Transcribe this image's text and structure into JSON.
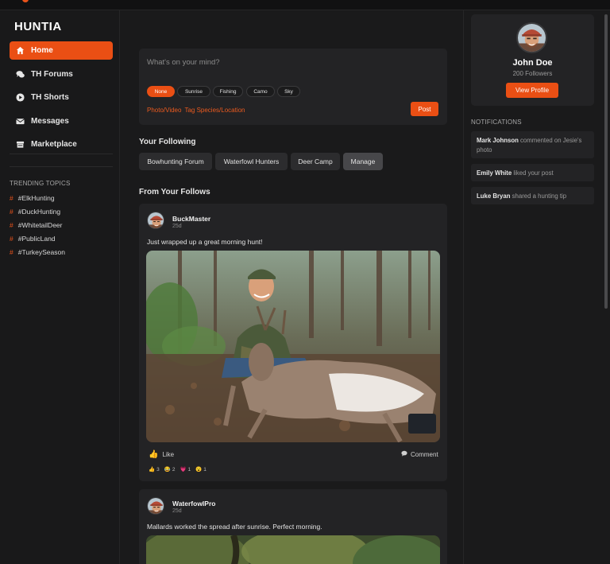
{
  "brand": "HUNTIA",
  "accent_color": "#ea4f14",
  "nav": [
    {
      "label": "Home",
      "icon": "home-icon",
      "active": true
    },
    {
      "label": "TH Forums",
      "icon": "chat-bubbles-icon",
      "active": false
    },
    {
      "label": "TH Shorts",
      "icon": "play-circle-icon",
      "active": false
    },
    {
      "label": "Messages",
      "icon": "envelope-icon",
      "active": false
    },
    {
      "label": "Marketplace",
      "icon": "storefront-icon",
      "active": false
    }
  ],
  "trending": {
    "title": "TRENDING TOPICS",
    "topics": [
      "#ElkHunting",
      "#DuckHunting",
      "#WhitetailDeer",
      "#PublicLand",
      "#TurkeySeason"
    ]
  },
  "composer": {
    "placeholder": "What's on your mind?",
    "filters": [
      "None",
      "Sunrise",
      "Fishing",
      "Camo",
      "Sky"
    ],
    "active_filter": "None",
    "photo_link": "Photo/Video",
    "tag_link": "Tag Species/Location",
    "post_label": "Post"
  },
  "following": {
    "title": "Your Following",
    "items": [
      "Bowhunting Forum",
      "Waterfowl Hunters",
      "Deer Camp"
    ],
    "manage_label": "Manage"
  },
  "feed": {
    "title": "From Your Follows",
    "posts": [
      {
        "author": "BuckMaster",
        "time": "25d",
        "text": "Just wrapped up a great morning hunt!",
        "like_label": "Like",
        "comment_label": "Comment",
        "reactions": [
          {
            "icon": "thumbs-up-icon",
            "count": "3"
          },
          {
            "icon": "laugh-icon",
            "count": "2"
          },
          {
            "icon": "heart-icon",
            "count": "1"
          },
          {
            "icon": "wow-icon",
            "count": "1"
          }
        ]
      },
      {
        "author": "WaterfowlPro",
        "time": "25d",
        "text": "Mallards worked the spread after sunrise. Perfect morning."
      }
    ]
  },
  "profile": {
    "name": "John Doe",
    "followers": "200 Followers",
    "button_label": "View Profile"
  },
  "notifications": {
    "title": "NOTIFICATIONS",
    "items": [
      {
        "user": "Mark Johnson",
        "text": " commented on Jesie's photo"
      },
      {
        "user": "Emily White",
        "text": " liked your post"
      },
      {
        "user": "Luke Bryan",
        "text": " shared a hunting tip"
      }
    ]
  }
}
